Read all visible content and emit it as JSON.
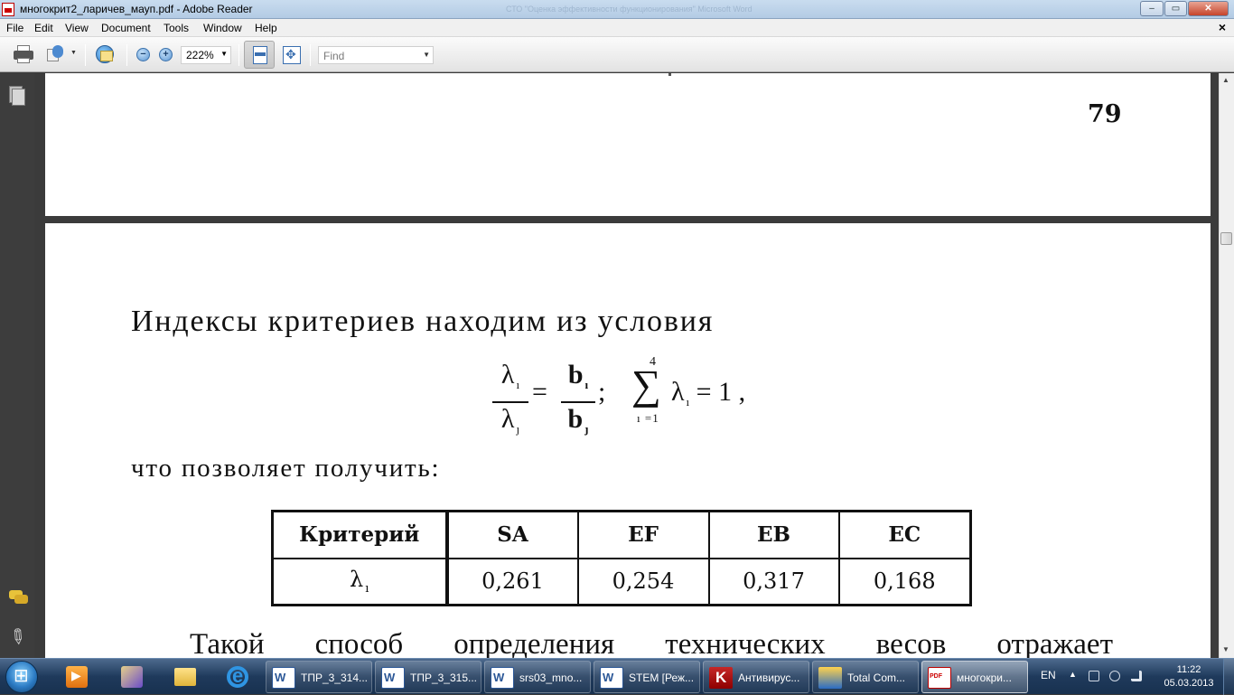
{
  "window": {
    "title": "многокрит2_ларичев_мауп.pdf - Adobe Reader",
    "background_title": "СТО \"Оценка эффективности функционирования\" Microsoft Word",
    "minimize": "‒",
    "maximize": "▭",
    "close": "✕"
  },
  "menu": {
    "items": [
      "File",
      "Edit",
      "View",
      "Document",
      "Tools",
      "Window",
      "Help"
    ],
    "doc_close": "×"
  },
  "toolbar": {
    "zoom_value": "222%",
    "find_placeholder": "Find",
    "zoom_out": "−",
    "zoom_in": "+"
  },
  "document": {
    "page_number": "79",
    "para_intro": "Индексы критериев находим из условия",
    "formula": {
      "lambda_i": "λ",
      "lambda_j": "λ",
      "b_i": "b",
      "b_j": "b",
      "sub_i": "ı",
      "sub_j": "ȷ",
      "equals": "=",
      "semicolon": ";",
      "sum_upper": "4",
      "sum_sign": "∑",
      "sum_lower": "ı =1",
      "sum_term": "λ",
      "sum_result": "= 1 ,"
    },
    "para_result": "что позволяет получить:",
    "table": {
      "headers": [
        "Критерий",
        "SA",
        "EF",
        "EB",
        "EC"
      ],
      "row_label": "λ",
      "row_label_sub": "ı",
      "values": [
        "0,261",
        "0,254",
        "0,317",
        "0,168"
      ]
    },
    "para_continue": "Такой способ определения технических весов отражает"
  },
  "taskbar": {
    "tasks": [
      {
        "label": "ТПР_3_314...",
        "icon": "word-icon"
      },
      {
        "label": "ТПР_3_315...",
        "icon": "word-icon"
      },
      {
        "label": "srs03_mno...",
        "icon": "word-icon"
      },
      {
        "label": "STEM [Реж...",
        "icon": "word-icon"
      },
      {
        "label": "Антивирус...",
        "icon": "kaspersky-icon"
      },
      {
        "label": "Total Com...",
        "icon": "total-commander-icon"
      },
      {
        "label": "многокри...",
        "icon": "pdf-icon"
      }
    ],
    "language": "EN",
    "time": "11:22",
    "date": "05.03.2013"
  },
  "colors": {
    "doc_background": "#3b3b3b",
    "taskbar": "#1f3a5c",
    "titlebar": "#c9dcef"
  }
}
